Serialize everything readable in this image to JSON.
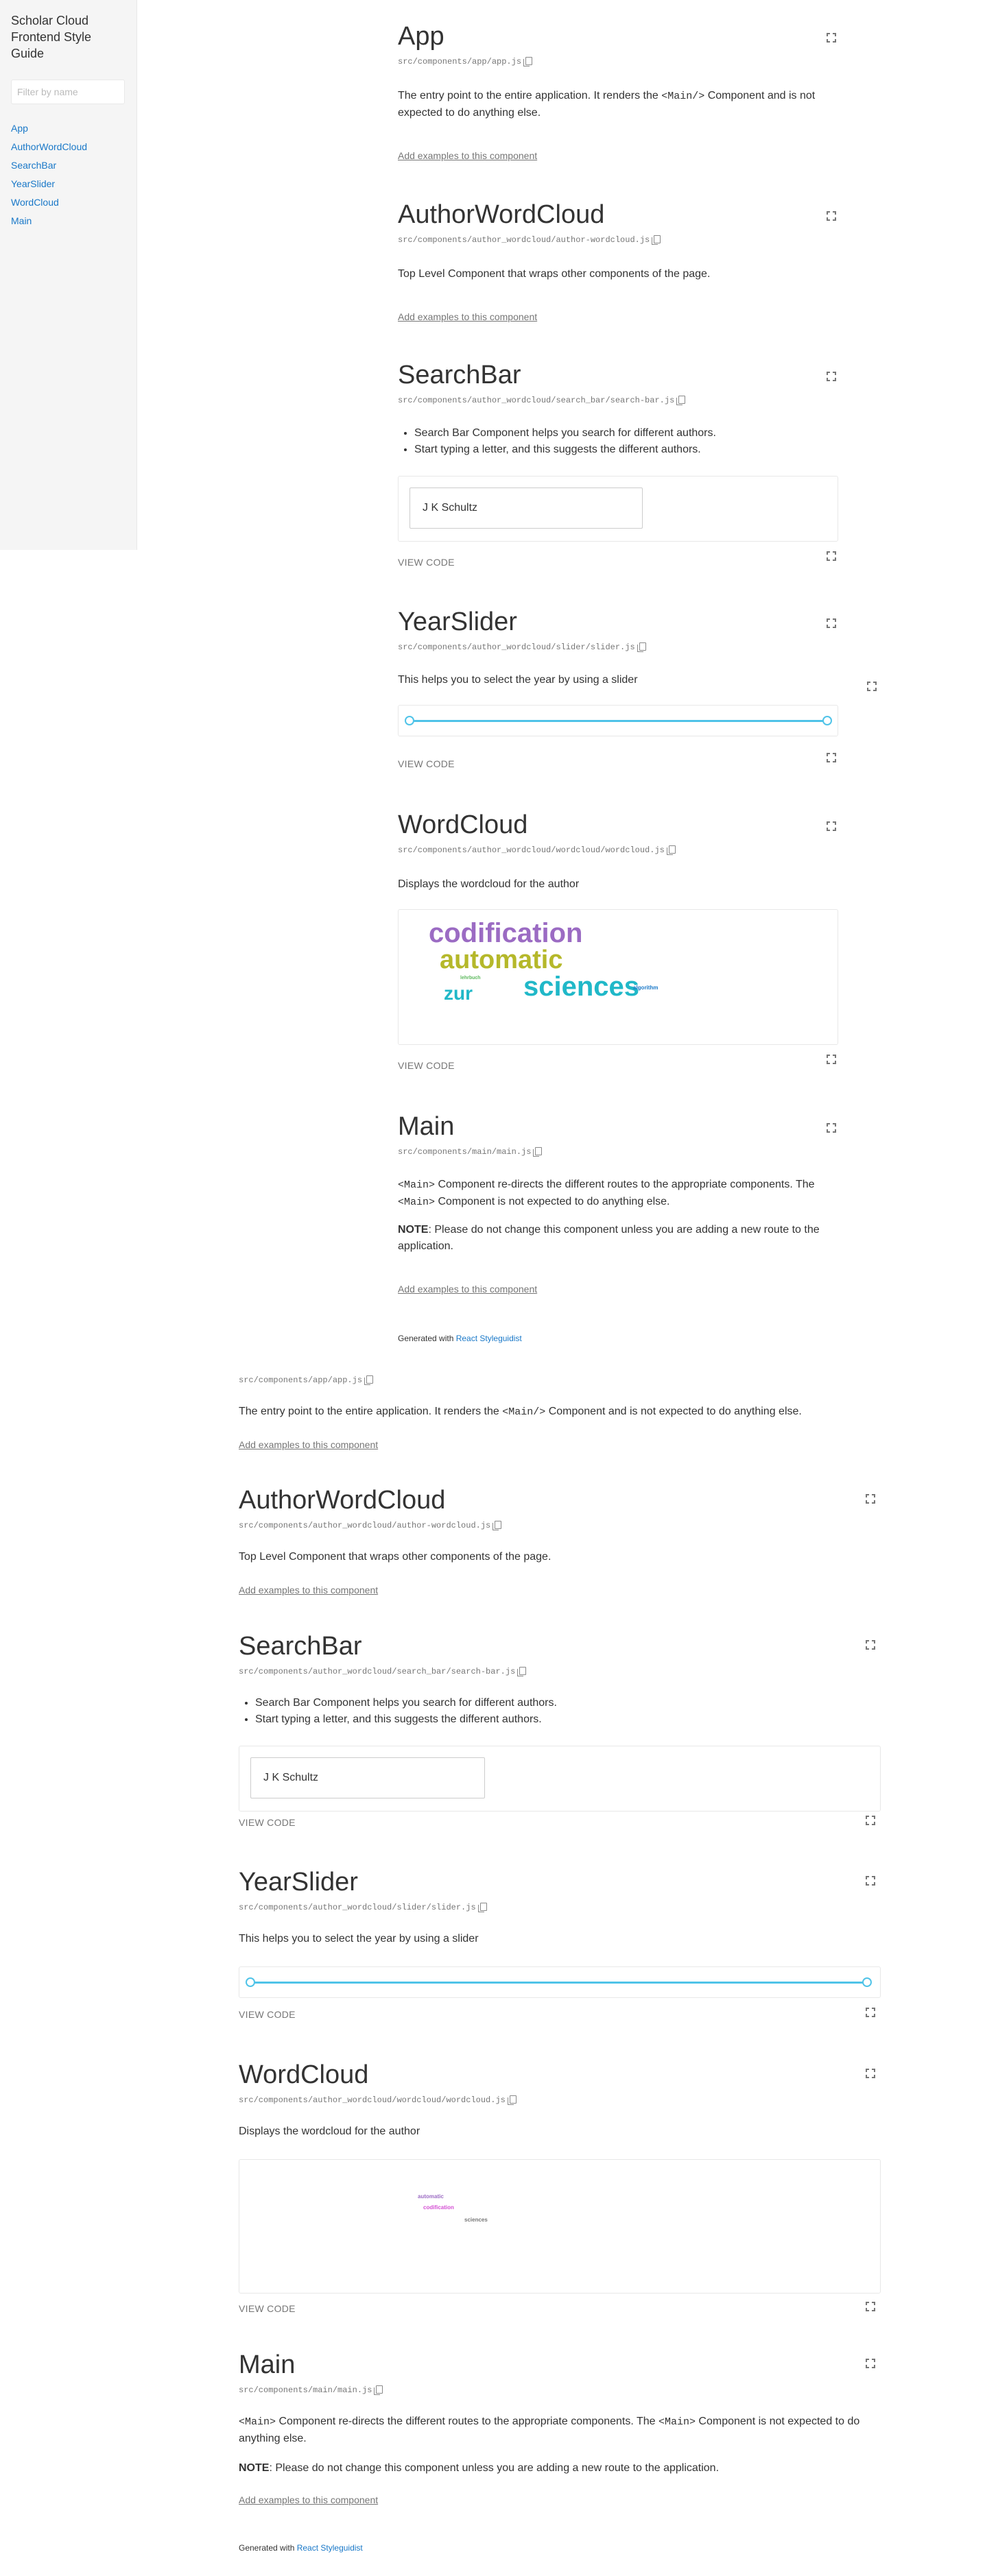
{
  "sidebar": {
    "brand": "Scholar Cloud Frontend Style Guide",
    "filter_placeholder": "Filter by name",
    "items": [
      "App",
      "AuthorWordCloud",
      "SearchBar",
      "YearSlider",
      "WordCloud",
      "Main"
    ]
  },
  "components": {
    "app": {
      "name": "App",
      "path": "src/components/app/app.js",
      "desc_pre": "The entry point to the entire application. It renders the ",
      "desc_code": "<Main/>",
      "desc_post": " Component and is not expected to do anything else."
    },
    "author_wordcloud": {
      "name": "AuthorWordCloud",
      "path": "src/components/author_wordcloud/author-wordcloud.js",
      "desc": "Top Level Component that wraps other components of the page."
    },
    "search_bar": {
      "name": "SearchBar",
      "path": "src/components/author_wordcloud/search_bar/search-bar.js",
      "bullets": [
        "Search Bar Component helps you search for different authors.",
        "Start typing a letter, and this suggests the different authors."
      ],
      "input_value": "J K Schultz"
    },
    "year_slider": {
      "name": "YearSlider",
      "path": "src/components/author_wordcloud/slider/slider.js",
      "desc": "This helps you to select the year by using a slider"
    },
    "word_cloud": {
      "name": "WordCloud",
      "path": "src/components/author_wordcloud/wordcloud/wordcloud.js",
      "desc": "Displays the wordcloud for the author",
      "words_top": [
        "codification",
        "automatic",
        "sciences",
        "zur",
        "lehrbuch",
        "algorithm"
      ],
      "words_bottom": [
        "automatic",
        "codification",
        "sciences"
      ]
    },
    "main": {
      "name": "Main",
      "path": "src/components/main/main.js",
      "code": "<Main>",
      "desc_a": " Component re-directs the different routes to the appropriate components. The ",
      "desc_b": " Component is not expected to do anything else.",
      "note_label": "NOTE",
      "note": ": Please do not change this component unless you are adding a new route to the application."
    }
  },
  "labels": {
    "add_examples": "Add examples to this component",
    "view_code": "VIEW CODE",
    "generated_with": "Generated with ",
    "styleguidist": "React Styleguidist"
  },
  "colors": {
    "link": "#1978c8",
    "slider": "#4fc3e8",
    "word_purple": "#9b6bc3",
    "word_olive": "#b5b82a",
    "word_teal": "#20b8c8",
    "word_green": "#5cb85c",
    "word_pink": "#d44fd4",
    "word_gray": "#777777"
  }
}
